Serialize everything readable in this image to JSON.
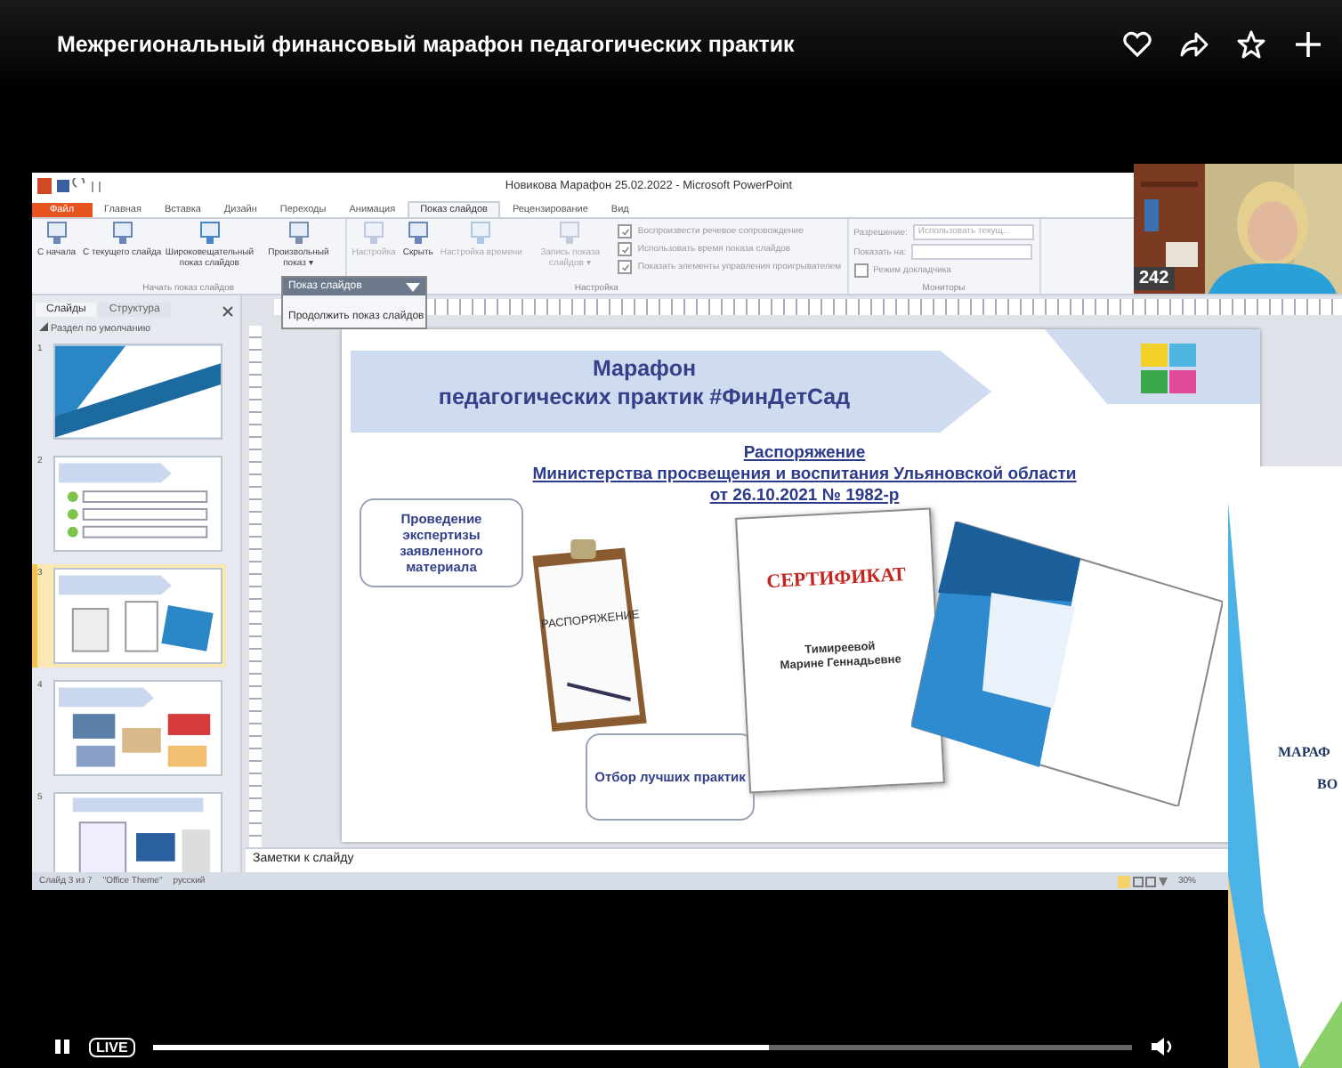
{
  "player": {
    "title": "Межрегиональный финансовый марафон педагогических практик",
    "live_label": "LIVE",
    "progress": {
      "level": 0.63
    }
  },
  "webcam": {
    "participant_count": "242"
  },
  "powerpoint": {
    "window_title": "Новикова Марафон 25.02.2022 - Microsoft PowerPoint",
    "ribbon_tabs": [
      {
        "label": "Файл",
        "selected": false,
        "kind": "file"
      },
      {
        "label": "Главная",
        "selected": false,
        "kind": "tab"
      },
      {
        "label": "Вставка",
        "selected": false,
        "kind": "tab"
      },
      {
        "label": "Дизайн",
        "selected": false,
        "kind": "tab"
      },
      {
        "label": "Переходы",
        "selected": false,
        "kind": "tab"
      },
      {
        "label": "Анимация",
        "selected": false,
        "kind": "tab"
      },
      {
        "label": "Показ слайдов",
        "selected": true,
        "kind": "tab"
      },
      {
        "label": "Рецензирование",
        "selected": false,
        "kind": "tab"
      },
      {
        "label": "Вид",
        "selected": false,
        "kind": "tab"
      }
    ],
    "ribbon_groups": [
      {
        "label": "Начать показ слайдов",
        "buttons": [
          {
            "label": "С начала",
            "disabled": false
          },
          {
            "label": "С текущего слайда",
            "disabled": false
          },
          {
            "label": "Широковещательный показ слайдов",
            "disabled": false
          },
          {
            "label": "Произвольный показ ▾",
            "disabled": false
          }
        ]
      },
      {
        "label": "Настройка",
        "buttons": [
          {
            "label": "Настройка",
            "disabled": true
          },
          {
            "label": "Скрыть",
            "disabled": false
          },
          {
            "label": "Настройка времени",
            "disabled": true
          },
          {
            "label": "Запись показа слайдов ▾",
            "disabled": true
          }
        ],
        "checkboxes": [
          {
            "label": "Воспроизвести речевое сопровождение",
            "checked": true
          },
          {
            "label": "Использовать время показа слайдов",
            "checked": true
          },
          {
            "label": "Показать элементы управления проигрывателем",
            "checked": true
          }
        ]
      },
      {
        "label": "Мониторы",
        "fields": [
          {
            "label": "Разрешение:",
            "value": "Использовать текущ..."
          },
          {
            "label": "Показать на:"
          }
        ],
        "checkboxes": [
          {
            "label": "Режим докладчика",
            "checked": false
          }
        ]
      }
    ],
    "popup": {
      "title": "Показ слайдов",
      "item": "Продолжить показ слайдов"
    },
    "panel_tabs": [
      {
        "label": "Слайды",
        "selected": true
      },
      {
        "label": "Структура",
        "selected": false
      }
    ],
    "section": "Раздел по умолчанию",
    "slides": [
      {
        "number": "1",
        "selected": false,
        "kind": "title"
      },
      {
        "number": "2",
        "selected": false,
        "kind": "list"
      },
      {
        "number": "3",
        "selected": true,
        "kind": "documents"
      },
      {
        "number": "4",
        "selected": false,
        "kind": "photos"
      },
      {
        "number": "5",
        "selected": false,
        "kind": "screens"
      }
    ],
    "slide": {
      "header": [
        "Марафон",
        "педагогических практик #ФинДетСад"
      ],
      "order_lines": [
        "Распоряжение",
        "Министерства просвещения и воспитания Ульяновской области",
        "от 26.10.2021  № 1982-р"
      ],
      "callouts": [
        "Проведение экспертизы заявленного материала",
        "Отбор лучших практик"
      ],
      "clipboard_text": "РАСПОРЯЖЕНИЕ",
      "certificate": {
        "title": "СЕРТИФИКАТ",
        "name_lines": [
          "Тимиреевой",
          "Марине Геннадьевне"
        ]
      }
    },
    "notes_placeholder": "Заметки к слайду",
    "status": [
      "Слайд 3 из 7",
      "\"Office Theme\"",
      "русский"
    ],
    "zoom": "30%"
  },
  "overlay_slide": {
    "lines": [
      "МАРАФ",
      "ВО"
    ]
  }
}
